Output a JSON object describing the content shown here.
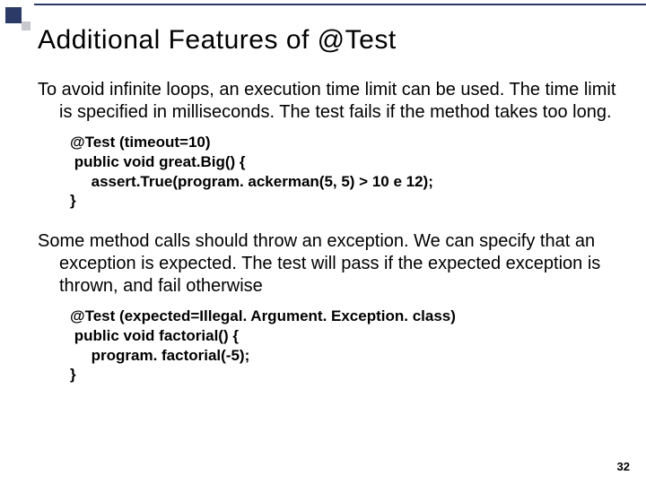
{
  "title": "Additional Features of @Test",
  "para1": "To avoid infinite loops, an execution time limit can be used. The time limit is specified in milliseconds. The test fails if the method takes too long.",
  "code1": "@Test (timeout=10)\n public void great.Big() {\n     assert.True(program. ackerman(5, 5) > 10 e 12);\n}",
  "para2": "Some method calls should throw an exception. We can specify that an exception is expected. The test will pass if the expected exception is thrown, and fail otherwise",
  "code2": "@Test (expected=Illegal. Argument. Exception. class)\n public void factorial() {\n     program. factorial(-5);\n}",
  "page_number": "32"
}
